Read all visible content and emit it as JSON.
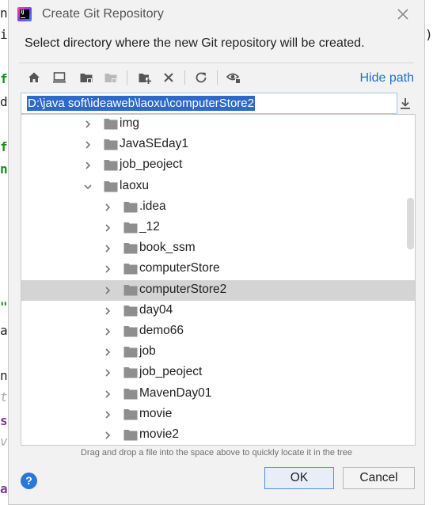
{
  "background": {
    "left_fragments": [
      "n",
      "i",
      "f",
      "d",
      "f",
      "n",
      "\"",
      "a",
      "n",
      "t",
      "s",
      "v",
      "a"
    ],
    "right_fragments": [
      ")"
    ]
  },
  "dialog": {
    "title": "Create Git Repository",
    "prompt": "Select directory where the new Git repository will be created.",
    "hide_path_label": "Hide path",
    "path_value": "D:\\java soft\\ideaweb\\laoxu\\computerStore2",
    "hint": "Drag and drop a file into the space above to quickly locate it in the tree",
    "ok_label": "OK",
    "cancel_label": "Cancel",
    "help_label": "?"
  },
  "toolbar": [
    {
      "name": "home-icon"
    },
    {
      "name": "desktop-icon"
    },
    {
      "name": "project-folder-icon"
    },
    {
      "name": "module-folder-icon"
    },
    {
      "name": "new-folder-icon"
    },
    {
      "name": "delete-icon"
    },
    {
      "name": "refresh-icon"
    },
    {
      "name": "show-hidden-icon"
    }
  ],
  "tree": [
    {
      "label": "img",
      "level": 0,
      "expanded": false,
      "selected": false
    },
    {
      "label": "JavaSEday1",
      "level": 0,
      "expanded": false,
      "selected": false
    },
    {
      "label": "job_peoject",
      "level": 0,
      "expanded": false,
      "selected": false
    },
    {
      "label": "laoxu",
      "level": 0,
      "expanded": true,
      "selected": false
    },
    {
      "label": ".idea",
      "level": 1,
      "expanded": false,
      "selected": false
    },
    {
      "label": "_12",
      "level": 1,
      "expanded": false,
      "selected": false
    },
    {
      "label": "book_ssm",
      "level": 1,
      "expanded": false,
      "selected": false
    },
    {
      "label": "computerStore",
      "level": 1,
      "expanded": false,
      "selected": false
    },
    {
      "label": "computerStore2",
      "level": 1,
      "expanded": false,
      "selected": true
    },
    {
      "label": "day04",
      "level": 1,
      "expanded": false,
      "selected": false
    },
    {
      "label": "demo66",
      "level": 1,
      "expanded": false,
      "selected": false
    },
    {
      "label": "job",
      "level": 1,
      "expanded": false,
      "selected": false
    },
    {
      "label": "job_peoject",
      "level": 1,
      "expanded": false,
      "selected": false
    },
    {
      "label": "MavenDay01",
      "level": 1,
      "expanded": false,
      "selected": false
    },
    {
      "label": "movie",
      "level": 1,
      "expanded": false,
      "selected": false
    },
    {
      "label": "movie2",
      "level": 1,
      "expanded": false,
      "selected": false
    }
  ],
  "colors": {
    "accent": "#2470c2",
    "selection": "#2e69c8",
    "folder": "#8e8e8e"
  }
}
